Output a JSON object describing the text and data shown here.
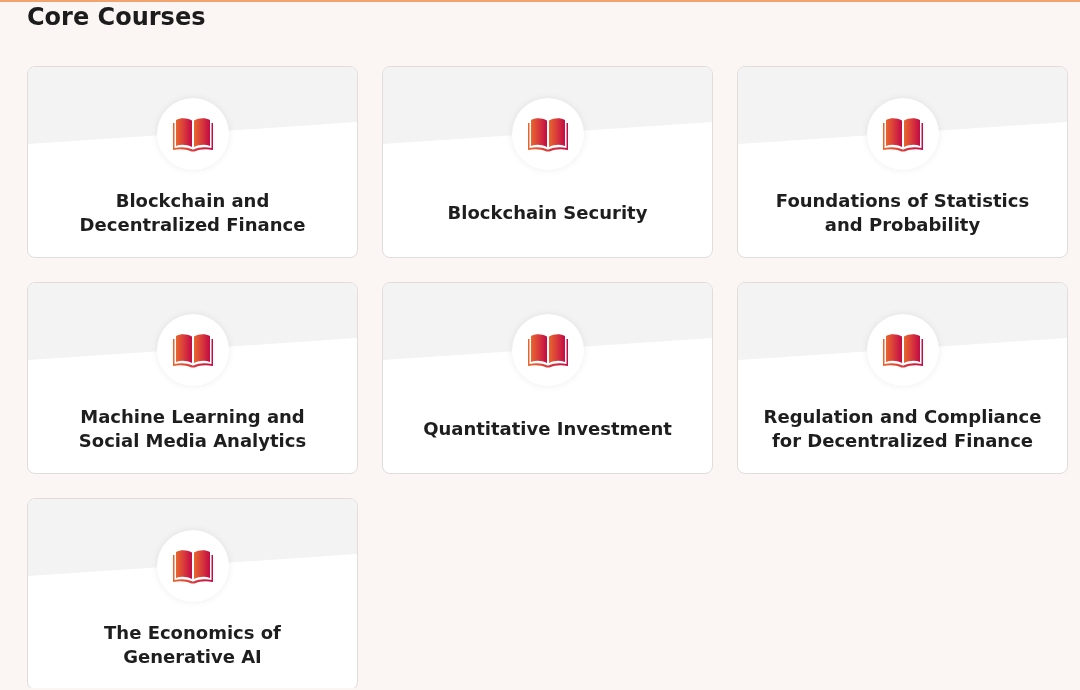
{
  "section": {
    "title": "Core Courses"
  },
  "courses": [
    {
      "title": "Blockchain and Decentralized Finance"
    },
    {
      "title": "Blockchain Security"
    },
    {
      "title": "Foundations of Statistics and Probability"
    },
    {
      "title": "Machine Learning and Social Media Analytics"
    },
    {
      "title": "Quantitative Investment"
    },
    {
      "title": "Regulation and Compliance for Decentralized Finance"
    },
    {
      "title": "The Economics of Generative AI"
    }
  ]
}
